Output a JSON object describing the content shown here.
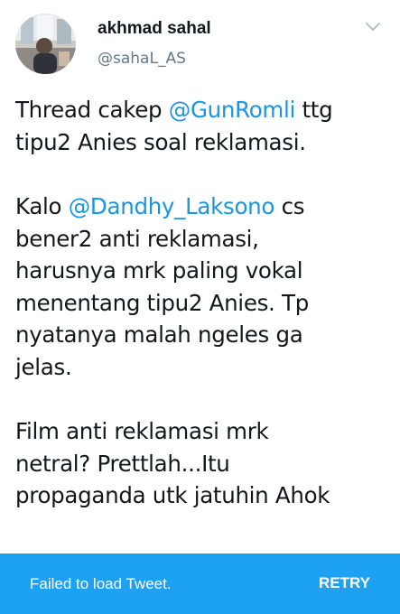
{
  "author": {
    "name": "akhmad sahal",
    "handle": "@sahaL_AS"
  },
  "tweet": {
    "p1": {
      "t1": "Thread cakep ",
      "m1": "@GunRomli",
      "t2": " ttg",
      "l2": "tipu2 Anies soal reklamasi."
    },
    "p2": {
      "t1": "Kalo ",
      "m1": "@Dandhy_Laksono",
      "t2": " cs",
      "l2": "bener2 anti reklamasi,",
      "l3": "harusnya mrk paling vokal",
      "l4": "menentang tipu2 Anies. Tp",
      "l5": "nyatanya malah ngeles ga",
      "l6": "jelas."
    },
    "p3": {
      "l1": "Film anti reklamasi mrk",
      "l2": "netral? Prettlah...Itu",
      "l3": "propaganda utk jatuhin Ahok"
    }
  },
  "snackbar": {
    "message": "Failed to load Tweet.",
    "action": "RETRY",
    "color": "#1da1f2"
  },
  "colors": {
    "mention": "#1b95e0",
    "text": "#14171a",
    "secondary": "#657786"
  },
  "icons": {
    "menu": "chevron-down-icon"
  }
}
